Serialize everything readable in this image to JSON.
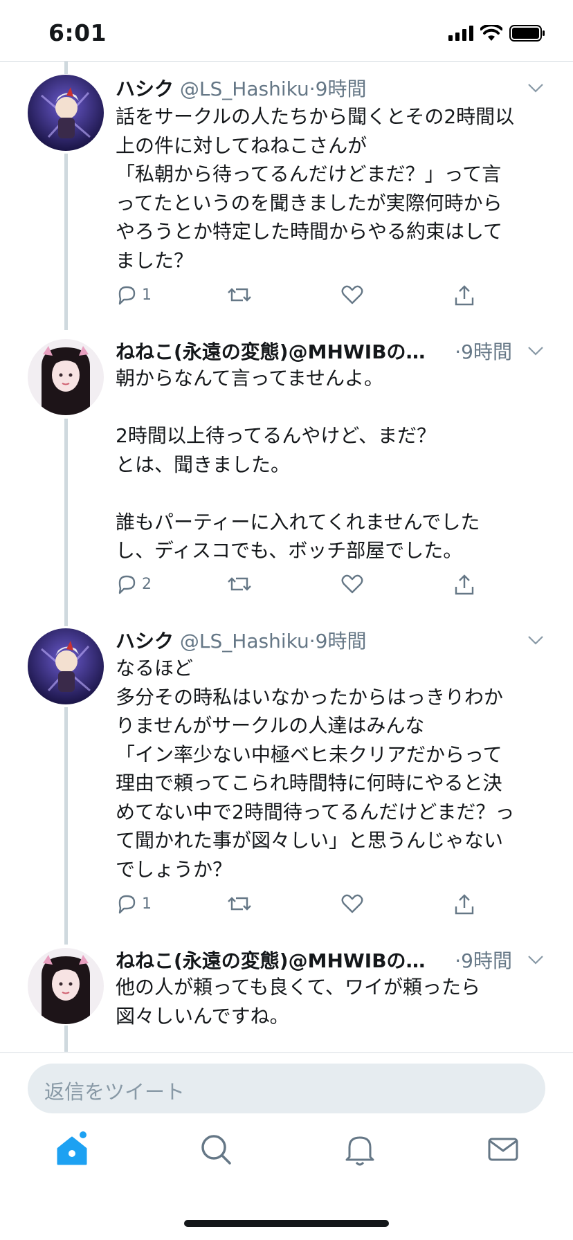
{
  "status_bar": {
    "time": "6:01"
  },
  "tweets": [
    {
      "name": "ハシク",
      "handle": "@LS_Hashiku",
      "time": "·9時間",
      "text": "話をサークルの人たちから聞くとその2時間以\n上の件に対してねねこさんが\n「私朝から待ってるんだけどまだ？」って言\nってたというのを聞きましたが実際何時から\nやろうとか特定した時間からやる約束はして\nました？",
      "reply_count": "1"
    },
    {
      "name": "ねねこ(永遠の変態)@MHWIBの…",
      "handle": "",
      "time": "·9時間",
      "text": "朝からなんて言ってませんよ。\n\n2時間以上待ってるんやけど、まだ？\nとは、聞きました。\n\n誰もパーティーに入れてくれませんでした\nし、ディスコでも、ボッチ部屋でした。",
      "reply_count": "2"
    },
    {
      "name": "ハシク",
      "handle": "@LS_Hashiku",
      "time": "·9時間",
      "text": "なるほど\n多分その時私はいなかったからはっきりわか\nりませんがサークルの人達はみんな\n「イン率少ない中極ベヒ未クリアだからって\n理由で頼ってこられ時間特に何時にやると決\nめてない中で2時間待ってるんだけどまだ？っ\nて聞かれた事が図々しい」と思うんじゃない\nでしょうか？",
      "reply_count": "1"
    },
    {
      "name": "ねねこ(永遠の変態)@MHWIBの…",
      "handle": "",
      "time": "·9時間",
      "text": "他の人が頼っても良くて、ワイが頼ったら\n図々しいんですね。",
      "reply_count": ""
    }
  ],
  "reply_bar": {
    "placeholder": "返信をツイート"
  },
  "tabs": [
    "home-icon",
    "search-icon",
    "notifications-icon",
    "messages-icon"
  ],
  "colors": {
    "accent": "#1da1f2",
    "secondary_text": "#657786",
    "reply_bg": "#e6ecf0"
  }
}
